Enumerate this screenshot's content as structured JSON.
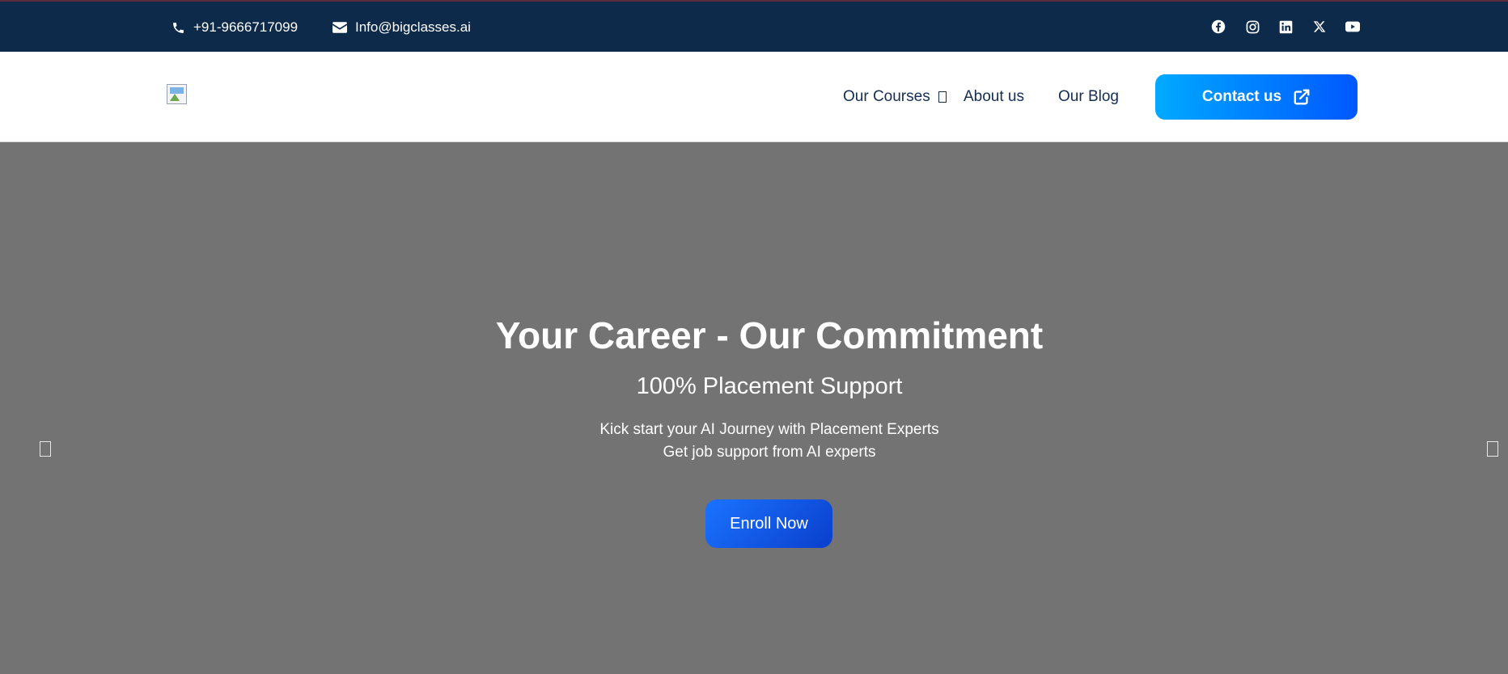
{
  "topbar": {
    "phone": "+91-9666717099",
    "email": "Info@bigclasses.ai",
    "social": [
      "facebook-icon",
      "instagram-icon",
      "linkedin-icon",
      "x-icon",
      "youtube-icon"
    ]
  },
  "header": {
    "nav": {
      "courses": "Our Courses",
      "about": "About us",
      "blog": "Our Blog"
    },
    "contact_label": "Contact us"
  },
  "hero": {
    "title": "Your Career - Our Commitment",
    "subtitle": "100% Placement Support",
    "line1": "Kick start your AI Journey with Placement Experts",
    "line2": "Get job support from AI experts",
    "cta": "Enroll Now"
  },
  "colors": {
    "topbar_bg": "#0e2a4a",
    "nav_text": "#132d55",
    "hero_bg": "#737373",
    "accent_start": "#00aaff",
    "accent_end": "#0057ff"
  }
}
